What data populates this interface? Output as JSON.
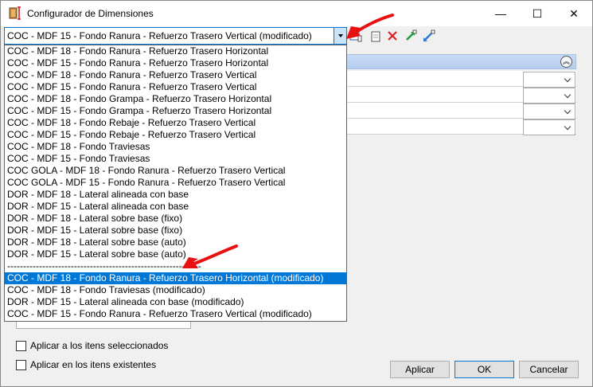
{
  "window": {
    "title": "Configurador de Dimensiones",
    "controls": {
      "minimize": "—",
      "maximize": "☐",
      "close": "✕"
    }
  },
  "combo": {
    "value": "COC - MDF 15 - Fondo Ranura - Refuerzo Trasero Vertical (modificado)"
  },
  "dropdown": {
    "options": [
      "COC - MDF 18 - Fondo Ranura - Refuerzo Trasero Horizontal",
      "COC - MDF 15 - Fondo Ranura - Refuerzo Trasero Horizontal",
      "COC - MDF 18 - Fondo Ranura - Refuerzo Trasero Vertical",
      "COC - MDF 15 - Fondo Ranura - Refuerzo Trasero Vertical",
      "COC - MDF 18 - Fondo Grampa - Refuerzo Trasero Horizontal",
      "COC - MDF 15 - Fondo Grampa - Refuerzo Trasero Horizontal",
      "COC - MDF 18 - Fondo Rebaje - Refuerzo Trasero Vertical",
      "COC - MDF 15 - Fondo Rebaje - Refuerzo Trasero Vertical",
      "COC - MDF 18 - Fondo Traviesas",
      "COC - MDF 15 - Fondo Traviesas",
      "COC GOLA - MDF 18 - Fondo Ranura - Refuerzo Trasero Vertical",
      "COC GOLA - MDF 15 - Fondo Ranura - Refuerzo Trasero Vertical",
      "DOR - MDF 18 - Lateral alineada con base",
      "DOR - MDF 15 - Lateral alineada con base",
      "DOR - MDF 18 - Lateral sobre base (fixo)",
      "DOR - MDF 15 - Lateral sobre base (fixo)",
      "DOR - MDF 18 - Lateral sobre base (auto)",
      "DOR - MDF 15 - Lateral sobre base (auto)",
      "-------------------------------------------------------------",
      "COC - MDF 18 - Fondo Ranura - Refuerzo Trasero Horizontal (modificado)",
      "COC - MDF 18 - Fondo Traviesas (modificado)",
      "DOR - MDF 15 - Lateral alineada con base (modificado)",
      "COC - MDF 15 - Fondo Ranura - Refuerzo Trasero Vertical (modificado)"
    ],
    "selected_index": 19
  },
  "checkboxes": {
    "apply_selected": "Aplicar a los itens seleccionados",
    "apply_existing": "Aplicar en los itens existentes"
  },
  "buttons": {
    "apply": "Aplicar",
    "ok": "OK",
    "cancel": "Cancelar"
  },
  "colors": {
    "selection": "#0078d7",
    "annotation_arrow": "#e81010"
  }
}
